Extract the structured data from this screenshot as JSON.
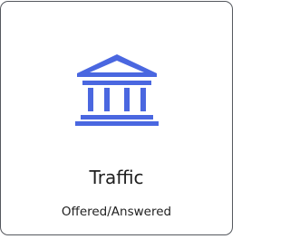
{
  "tile": {
    "title": "Traffic",
    "subtitle": "Offered/Answered",
    "icon": "bank-icon",
    "accent_color": "#4a67e0"
  }
}
